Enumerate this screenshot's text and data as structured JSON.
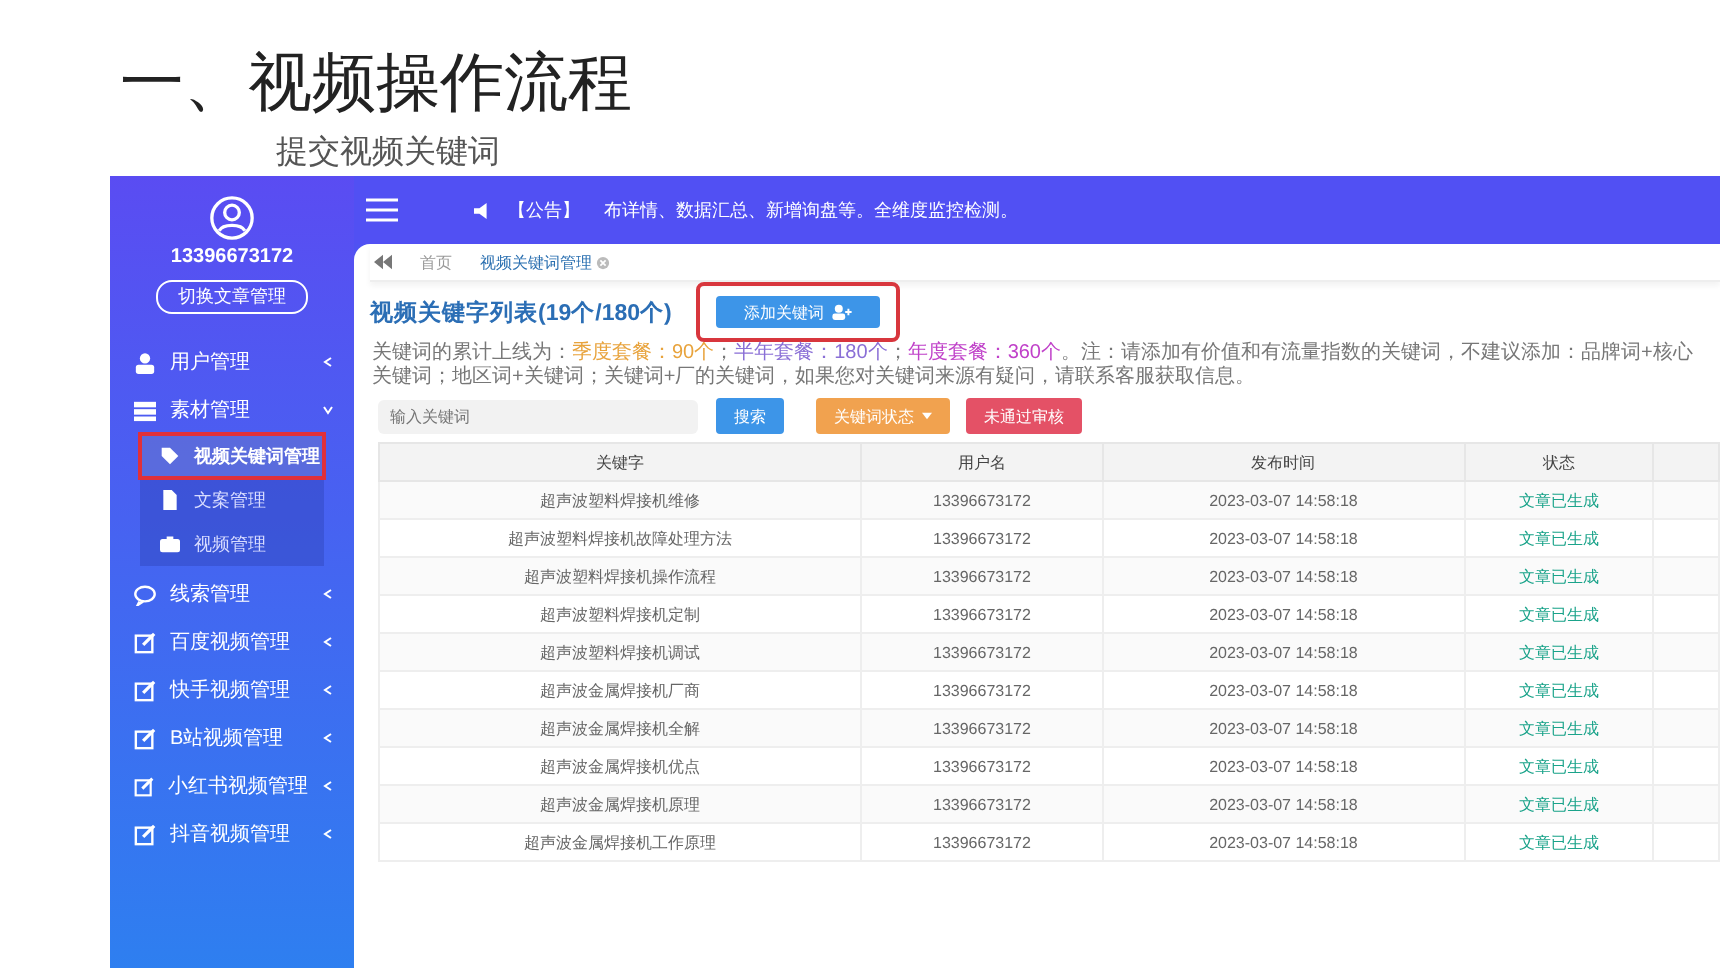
{
  "slide": {
    "title": "一、视频操作流程",
    "subtitle": "提交视频关键词"
  },
  "sidebar": {
    "username": "13396673172",
    "switch_button": "切换文章管理",
    "items": [
      {
        "label": "用户管理",
        "kind": "user",
        "expanded": false
      },
      {
        "label": "素材管理",
        "kind": "material",
        "expanded": true,
        "children": [
          {
            "label": "视频关键词管理",
            "kind": "tag",
            "selected": true,
            "annotated": true
          },
          {
            "label": "文案管理",
            "kind": "file",
            "selected": false,
            "annotated": false
          },
          {
            "label": "视频管理",
            "kind": "camera",
            "selected": false,
            "annotated": false
          }
        ]
      },
      {
        "label": "线索管理",
        "kind": "chat",
        "expanded": false
      },
      {
        "label": "百度视频管理",
        "kind": "edit",
        "expanded": false
      },
      {
        "label": "快手视频管理",
        "kind": "edit",
        "expanded": false
      },
      {
        "label": "B站视频管理",
        "kind": "edit",
        "expanded": false
      },
      {
        "label": "小红书视频管理",
        "kind": "edit",
        "expanded": false
      },
      {
        "label": "抖音视频管理",
        "kind": "edit",
        "expanded": false
      }
    ]
  },
  "topbar": {
    "notice_tag": "【公告】",
    "notice": "布详情、数据汇总、新增询盘等。全维度监控检测。"
  },
  "breadcrumb": [
    {
      "label": "首页",
      "selected": false,
      "closable": false
    },
    {
      "label": "视频关键词管理",
      "selected": true,
      "closable": true
    }
  ],
  "page": {
    "title": "视频关键字列表(19个/180个)",
    "add_button": {
      "label": "添加关键词",
      "annotated": true
    },
    "notice": [
      {
        "text": "关键词的累计上线为：",
        "color": "#777777"
      },
      {
        "text": "季度套餐：90个",
        "color": "#e8a33c"
      },
      {
        "text": "；",
        "color": "#777777"
      },
      {
        "text": "半年套餐：180个",
        "color": "#8a6fd6"
      },
      {
        "text": "；",
        "color": "#777777"
      },
      {
        "text": "年度套餐：360个",
        "color": "#c041c9"
      },
      {
        "text": "。注：请添加有价值和有流量指数的关键词，不建议添加：品牌词+核心关键词；地区词+关键词；关键词+厂的关键词，如果您对关键词来源有疑问，请联系客服获取信息。",
        "color": "#777777"
      }
    ]
  },
  "toolbar": {
    "search_placeholder": "输入关键词",
    "search_button": "搜索",
    "status_dropdown": "关键词状态",
    "reject_button": "未通过审核"
  },
  "table": {
    "columns": [
      "关键字",
      "用户名",
      "发布时间",
      "状态"
    ],
    "rows": [
      [
        "超声波塑料焊接机维修",
        "13396673172",
        "2023-03-07 14:58:18",
        "文章已生成"
      ],
      [
        "超声波塑料焊接机故障处理方法",
        "13396673172",
        "2023-03-07 14:58:18",
        "文章已生成"
      ],
      [
        "超声波塑料焊接机操作流程",
        "13396673172",
        "2023-03-07 14:58:18",
        "文章已生成"
      ],
      [
        "超声波塑料焊接机定制",
        "13396673172",
        "2023-03-07 14:58:18",
        "文章已生成"
      ],
      [
        "超声波塑料焊接机调试",
        "13396673172",
        "2023-03-07 14:58:18",
        "文章已生成"
      ],
      [
        "超声波金属焊接机厂商",
        "13396673172",
        "2023-03-07 14:58:18",
        "文章已生成"
      ],
      [
        "超声波金属焊接机全解",
        "13396673172",
        "2023-03-07 14:58:18",
        "文章已生成"
      ],
      [
        "超声波金属焊接机优点",
        "13396673172",
        "2023-03-07 14:58:18",
        "文章已生成"
      ],
      [
        "超声波金属焊接机原理",
        "13396673172",
        "2023-03-07 14:58:18",
        "文章已生成"
      ],
      [
        "超声波金属焊接机工作原理",
        "13396673172",
        "2023-03-07 14:58:18",
        "文章已生成"
      ]
    ]
  }
}
